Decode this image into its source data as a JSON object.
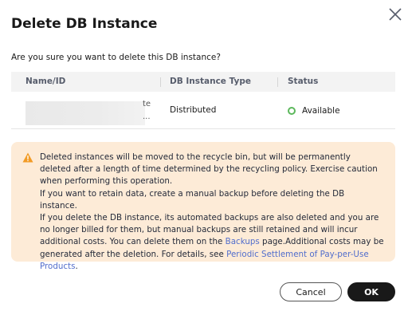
{
  "dialog": {
    "title": "Delete DB Instance",
    "question": "Are you sure you want to delete this DB instance?"
  },
  "table": {
    "columns": [
      "Name/ID",
      "DB Instance Type",
      "Status"
    ],
    "row": {
      "name_visible_fragment_1": "te",
      "name_visible_fragment_2": "...",
      "type": "Distributed",
      "status": "Available"
    }
  },
  "warning": {
    "line1": "Deleted instances will be moved to the recycle bin, but will be permanently deleted after a length of time determined by the recycling policy. Exercise caution when performing this operation.",
    "line2": "If you want to retain data, create a manual backup before deleting the DB instance.",
    "line3_pre": "If you delete the DB instance, its automated backups are also deleted and you are no longer billed for them, but manual backups are still retained and will incur additional costs. You can delete them on the ",
    "backups_link": "Backups",
    "line3_mid": " page.Additional costs may be generated after the deletion. For details, see ",
    "periodic_link": "Periodic Settlement of Pay-per-Use Products",
    "line3_end": "."
  },
  "buttons": {
    "cancel": "Cancel",
    "ok": "OK"
  },
  "colors": {
    "warning_bg": "#fdebd7",
    "warning_icon": "#f29b25",
    "status_available": "#5cb85c",
    "link": "#526ecc",
    "ok_button_bg": "#191919"
  }
}
